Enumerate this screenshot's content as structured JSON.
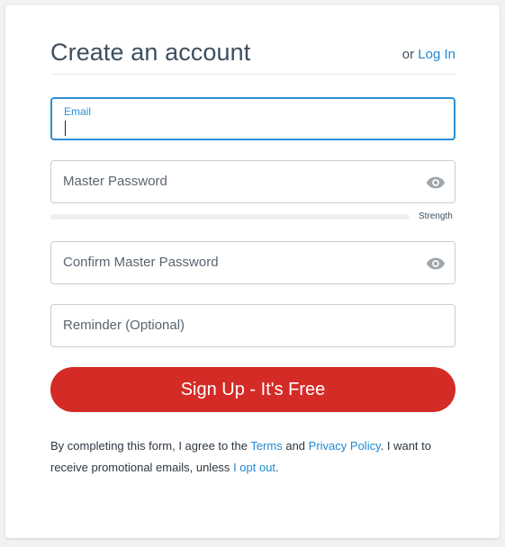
{
  "header": {
    "title": "Create an account",
    "login_prefix": "or",
    "login_link": "Log In"
  },
  "fields": {
    "email": {
      "label": "Email",
      "value": ""
    },
    "master_password": {
      "placeholder": "Master Password",
      "icon": "eye-icon"
    },
    "strength": {
      "label": "Strength",
      "level": 0
    },
    "confirm_password": {
      "placeholder": "Confirm Master Password",
      "icon": "eye-icon"
    },
    "reminder": {
      "placeholder": "Reminder (Optional)"
    }
  },
  "signup_button": {
    "label": "Sign Up - It's Free"
  },
  "terms": {
    "text1": "By completing this form, I agree to the",
    "terms_link": "Terms",
    "text2": "and",
    "privacy_link": "Privacy Policy",
    "text3": ". I want to receive promotional emails, unless",
    "optout_link": "I opt out",
    "text4": "."
  },
  "colors": {
    "accent_blue": "#1d8ad3",
    "focus_border": "#2d8fd6",
    "signup_red": "#d42b26",
    "title_text": "#3d4f5f"
  }
}
